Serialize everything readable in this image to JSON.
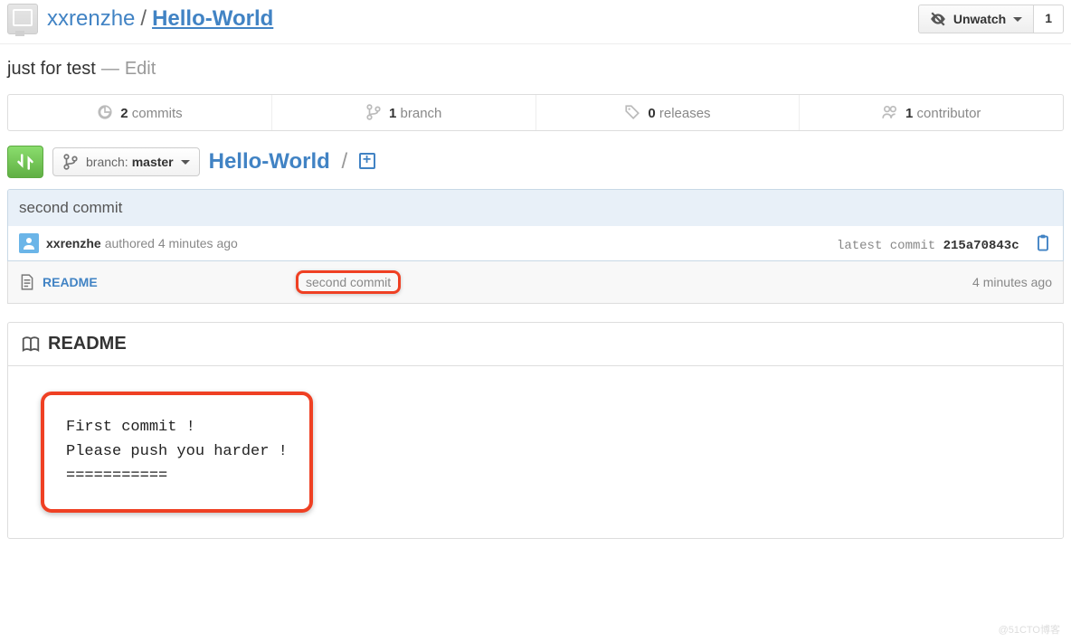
{
  "header": {
    "owner": "xxrenzhe",
    "slash": "/",
    "repo": "Hello-World",
    "watch_label": "Unwatch",
    "watch_count": "1"
  },
  "description": {
    "text": "just for test",
    "dash": "—",
    "edit": "Edit"
  },
  "stats": {
    "commits_num": "2",
    "commits_label": "commits",
    "branch_num": "1",
    "branch_label": "branch",
    "releases_num": "0",
    "releases_label": "releases",
    "contrib_num": "1",
    "contrib_label": "contributor"
  },
  "filenav": {
    "branch_prefix": "branch:",
    "branch_name": "master",
    "breadcrumb_repo": "Hello-World",
    "breadcrumb_sep": "/"
  },
  "commit": {
    "title": "second commit",
    "author": "xxrenzhe",
    "authored_text": "authored 4 minutes ago",
    "latest_label": "latest commit ",
    "sha": "215a70843c"
  },
  "files": {
    "readme_name": "README",
    "readme_msg": "second commit",
    "readme_age": "4 minutes ago"
  },
  "readme": {
    "title": "README",
    "body": "First commit !\nPlease push you harder !\n==========="
  },
  "watermark": "@51CTO博客"
}
